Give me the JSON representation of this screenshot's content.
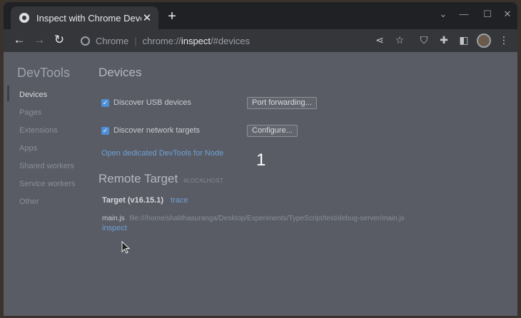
{
  "browser": {
    "tab_title": "Inspect with Chrome Developer Tools",
    "tab_close": "✕",
    "new_tab": "+",
    "window_controls": {
      "minimize": "⌄",
      "restore": "—",
      "maximize": "☐",
      "close": "✕"
    },
    "omnibox": {
      "site_label": "Chrome",
      "url_scheme": "chrome://",
      "url_host": "inspect",
      "url_path": "/#devices"
    },
    "icons": {
      "back": "arrow-left-icon",
      "forward": "arrow-right-icon",
      "reload": "reload-icon",
      "share": "share-icon",
      "bookmark": "star-icon",
      "extension": "puzzle-icon",
      "sidepanel": "side-panel-icon",
      "menu": "kebab-menu-icon"
    }
  },
  "sidebar": {
    "title": "DevTools",
    "items": [
      {
        "label": "Devices"
      },
      {
        "label": "Pages"
      },
      {
        "label": "Extensions"
      },
      {
        "label": "Apps"
      },
      {
        "label": "Shared workers"
      },
      {
        "label": "Service workers"
      },
      {
        "label": "Other"
      }
    ]
  },
  "main": {
    "title": "Devices",
    "usb": {
      "label": "Discover USB devices",
      "checked": true,
      "button": "Port forwarding..."
    },
    "network": {
      "label": "Discover network targets",
      "checked": true,
      "button": "Configure..."
    },
    "node_link": "Open dedicated DevTools for Node",
    "step_number": "1",
    "remote": {
      "title": "Remote Target",
      "tag": "#LOCALHOST",
      "target_name": "Target (v16.15.1)",
      "trace_link": "trace",
      "file_name": "main.js",
      "file_path": "file:///home/shalithasuranga/Desktop/Experiments/TypeScript/test/debug-server/main.js",
      "inspect_link": "inspect"
    }
  }
}
